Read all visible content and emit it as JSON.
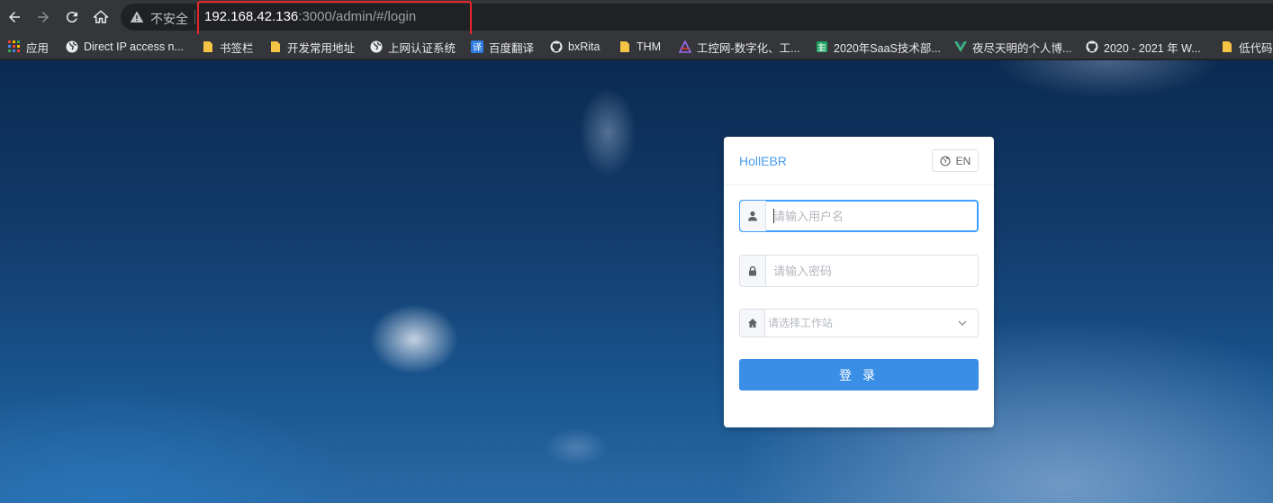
{
  "browser": {
    "nav": {
      "back_icon": "arrow-left-icon",
      "forward_icon": "arrow-right-icon",
      "reload_icon": "reload-icon",
      "home_icon": "home-icon"
    },
    "address": {
      "security_label": "不安全",
      "host": "192.168.42.136",
      "rest": ":3000/admin/#/login"
    },
    "annotation_color": "#e5262a"
  },
  "bookmarks": [
    {
      "label": "应用",
      "icon": "apps-grid-icon"
    },
    {
      "label": "Direct IP access n...",
      "icon": "globe-icon"
    },
    {
      "label": "书签栏",
      "icon": "folder-icon"
    },
    {
      "label": "开发常用地址",
      "icon": "folder-icon"
    },
    {
      "label": "上网认证系统",
      "icon": "globe-icon"
    },
    {
      "label": "百度翻译",
      "icon": "translate-icon"
    },
    {
      "label": "bxRita",
      "icon": "github-icon"
    },
    {
      "label": "THM",
      "icon": "folder-icon"
    },
    {
      "label": "工控网-数字化、工...",
      "icon": "site-logo-icon"
    },
    {
      "label": "2020年SaaS技术部...",
      "icon": "sheet-icon"
    },
    {
      "label": "夜尽天明的个人博...",
      "icon": "vue-icon"
    },
    {
      "label": "2020 - 2021 年 W...",
      "icon": "github-icon"
    },
    {
      "label": "低代码",
      "icon": "folder-icon"
    }
  ],
  "login": {
    "brand": "HollEBR",
    "lang_button": "EN",
    "username_placeholder": "请输入用户名",
    "password_placeholder": "请输入密码",
    "workstation_placeholder": "请选择工作站",
    "submit_label": "登 录"
  },
  "colors": {
    "primary": "#3a8ee6",
    "brand_text": "#4a9bea",
    "focus_border": "#409eff"
  }
}
